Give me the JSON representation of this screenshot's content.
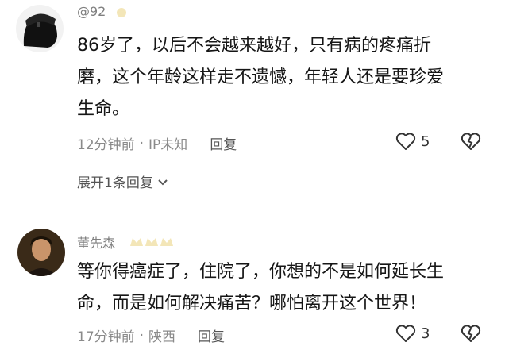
{
  "comments": [
    {
      "username": "@92",
      "text_lines": [
        "86岁了，以后不会越来越好，只有病的疼痛折",
        "磨，这个年龄这样走不遗憾，年轻人还是要珍爱",
        "生命。"
      ],
      "time": "12分钟前",
      "dot": "·",
      "location": "IP未知",
      "reply_label": "回复",
      "likes": "5",
      "expand_label": "展开1条回复"
    },
    {
      "username": "董先森",
      "text_lines": [
        "等你得癌症了，住院了，你想的不是如何延长生",
        "命，而是如何解决痛苦？哪怕离开这个世界！"
      ],
      "time": "17分钟前",
      "dot": "·",
      "location": "陕西",
      "reply_label": "回复",
      "likes": "3"
    }
  ],
  "colors": {
    "meta": "#8a8a8a",
    "badge": "#f3e6b8"
  }
}
